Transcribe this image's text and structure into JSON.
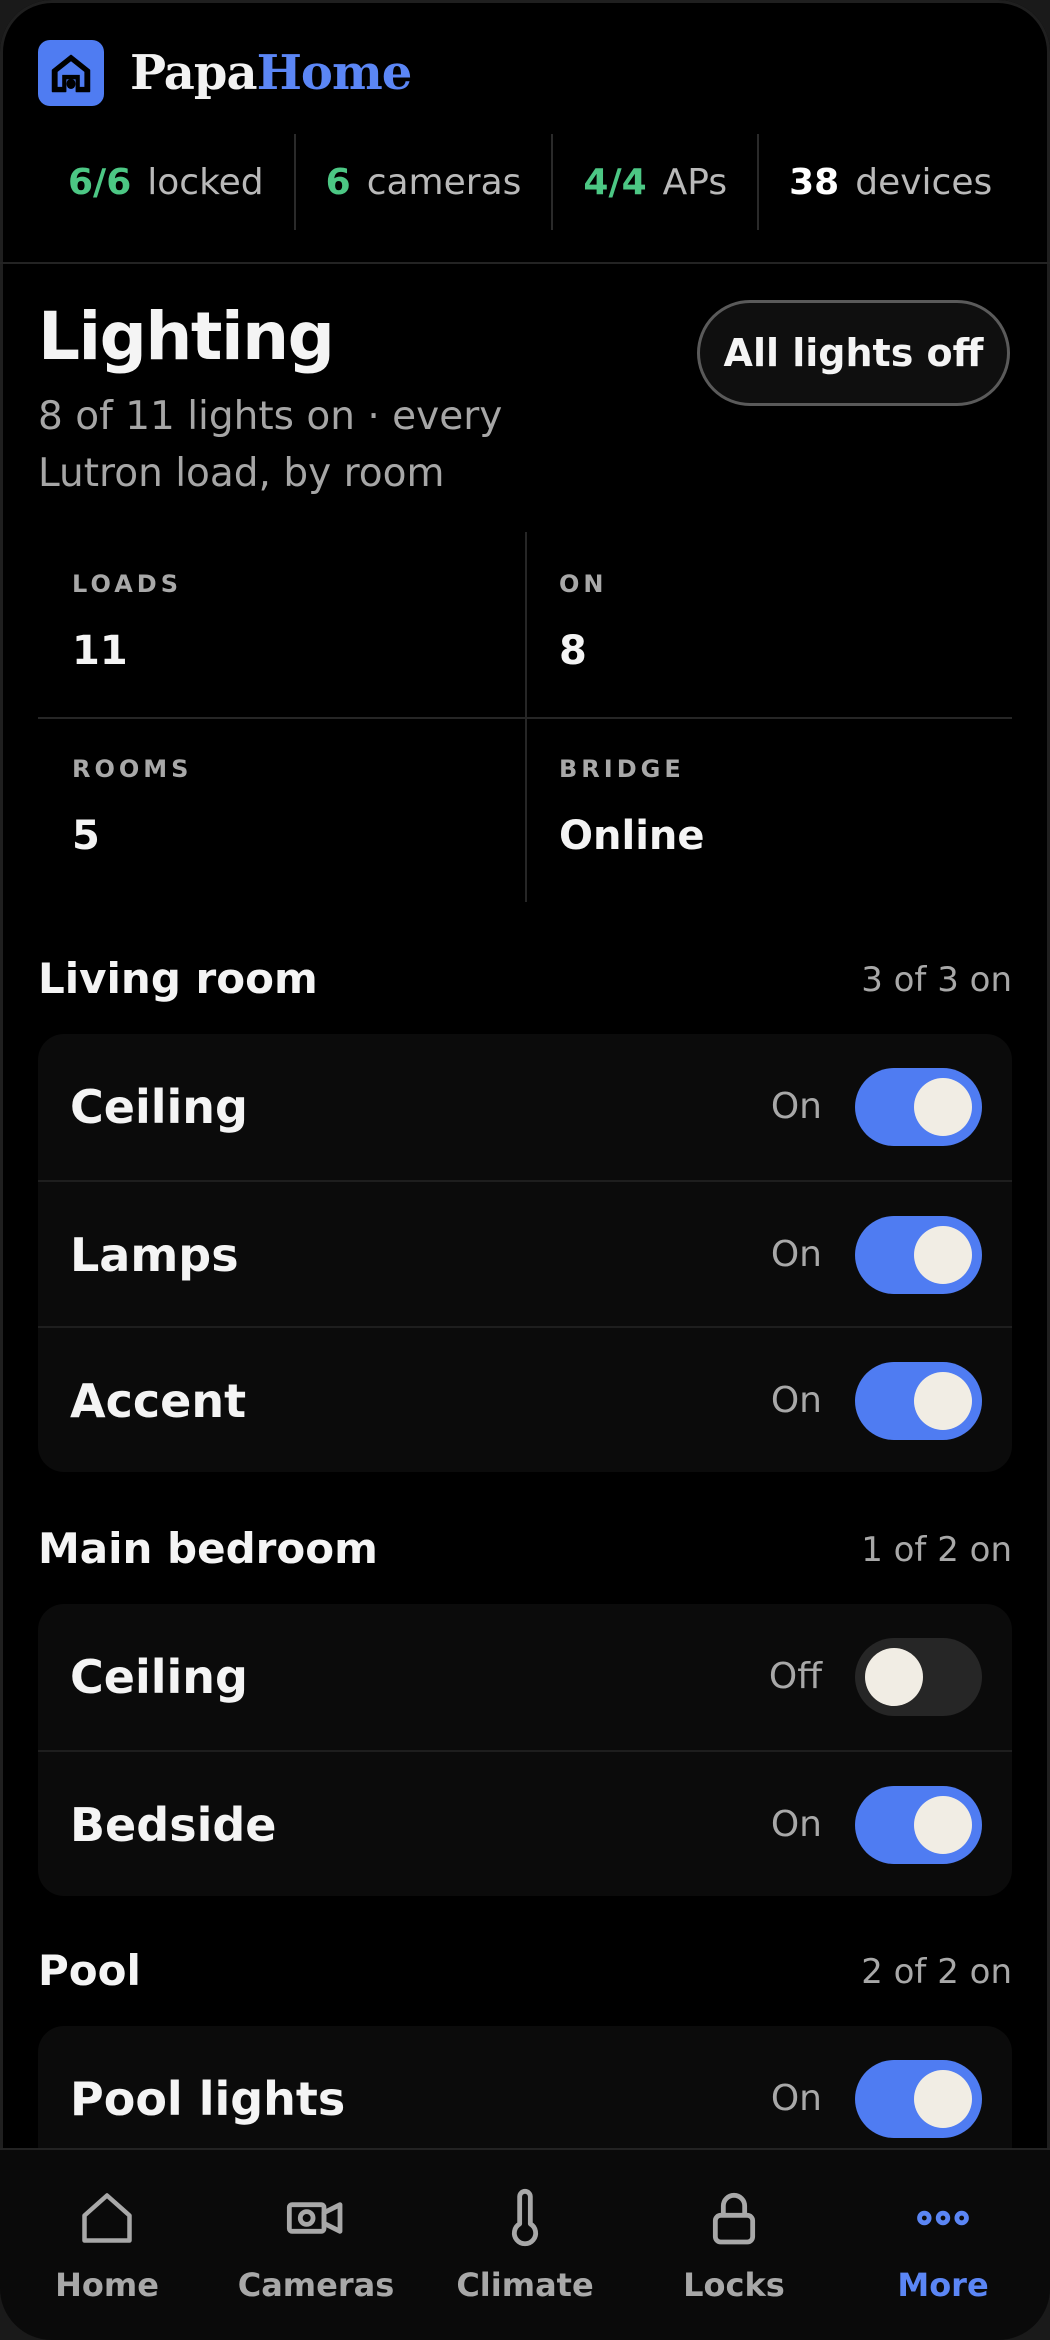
{
  "brand": {
    "part1": "Papa",
    "part2": "Home"
  },
  "stats": [
    {
      "num": "6/6",
      "label": "locked",
      "tone": "green"
    },
    {
      "num": "6",
      "label": "cameras",
      "tone": "green"
    },
    {
      "num": "4/4",
      "label": "APs",
      "tone": "green"
    },
    {
      "num": "38",
      "label": "devices",
      "tone": "white"
    }
  ],
  "page": {
    "title": "Lighting",
    "subtitle": "8 of 11 lights on · every Lutron load, by room",
    "all_off_label": "All lights off"
  },
  "summary": [
    {
      "label": "LOADS",
      "value": "11"
    },
    {
      "label": "ON",
      "value": "8"
    },
    {
      "label": "ROOMS",
      "value": "5"
    },
    {
      "label": "BRIDGE",
      "value": "Online"
    }
  ],
  "rooms": [
    {
      "name": "Living room",
      "count": "3 of 3 on",
      "loads": [
        {
          "name": "Ceiling",
          "state": "On",
          "on": true
        },
        {
          "name": "Lamps",
          "state": "On",
          "on": true
        },
        {
          "name": "Accent",
          "state": "On",
          "on": true
        }
      ]
    },
    {
      "name": "Main bedroom",
      "count": "1 of 2 on",
      "loads": [
        {
          "name": "Ceiling",
          "state": "Off",
          "on": false
        },
        {
          "name": "Bedside",
          "state": "On",
          "on": true
        }
      ]
    },
    {
      "name": "Pool",
      "count": "2 of 2 on",
      "loads": [
        {
          "name": "Pool lights",
          "state": "On",
          "on": true
        }
      ]
    }
  ],
  "nav": [
    {
      "label": "Home",
      "icon": "home-icon",
      "active": false
    },
    {
      "label": "Cameras",
      "icon": "camera-icon",
      "active": false
    },
    {
      "label": "Climate",
      "icon": "thermometer-icon",
      "active": false
    },
    {
      "label": "Locks",
      "icon": "lock-icon",
      "active": false
    },
    {
      "label": "More",
      "icon": "more-icon",
      "active": true
    }
  ],
  "colors": {
    "accent": "#4f7cf2",
    "green": "#4cc784",
    "background": "#000000"
  }
}
